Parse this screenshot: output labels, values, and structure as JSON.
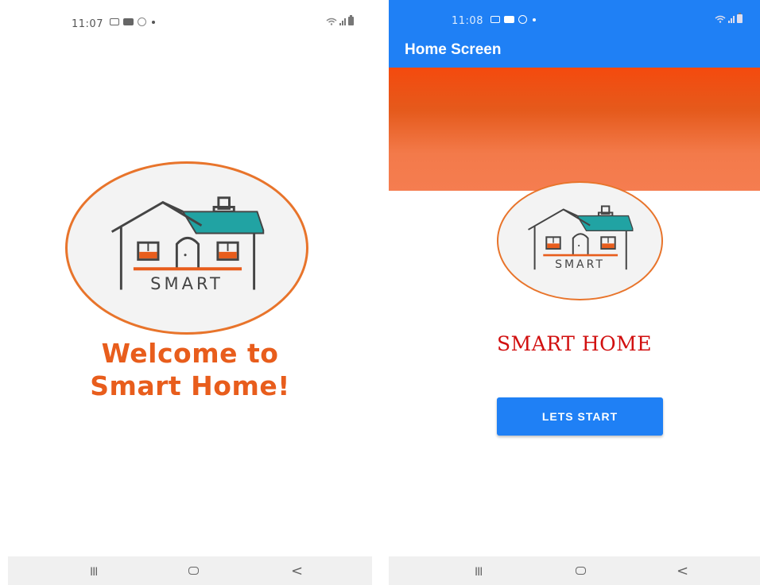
{
  "left_screen": {
    "status_bar": {
      "time": "11:07"
    },
    "logo": {
      "text": "SMART",
      "colors": {
        "ring": "#e8742b",
        "roof": "#21a3a3",
        "window": "#e85d1c",
        "line": "#444444"
      }
    },
    "welcome_line1": "Welcome to",
    "welcome_line2": "Smart Home!",
    "nav_bar": {
      "recent": "III",
      "back": "<"
    }
  },
  "right_screen": {
    "status_bar": {
      "time": "11:08"
    },
    "app_bar": {
      "title": "Home Screen",
      "color": "#1f80f5"
    },
    "banner": {
      "colors": [
        "#f44a0e",
        "#e55a1c",
        "#f57d50"
      ]
    },
    "logo": {
      "text": "SMART"
    },
    "title": "SMART HOME",
    "start_button": {
      "label": "LETS START",
      "color": "#1f80f5"
    },
    "nav_bar": {
      "recent": "III",
      "back": "<"
    }
  }
}
